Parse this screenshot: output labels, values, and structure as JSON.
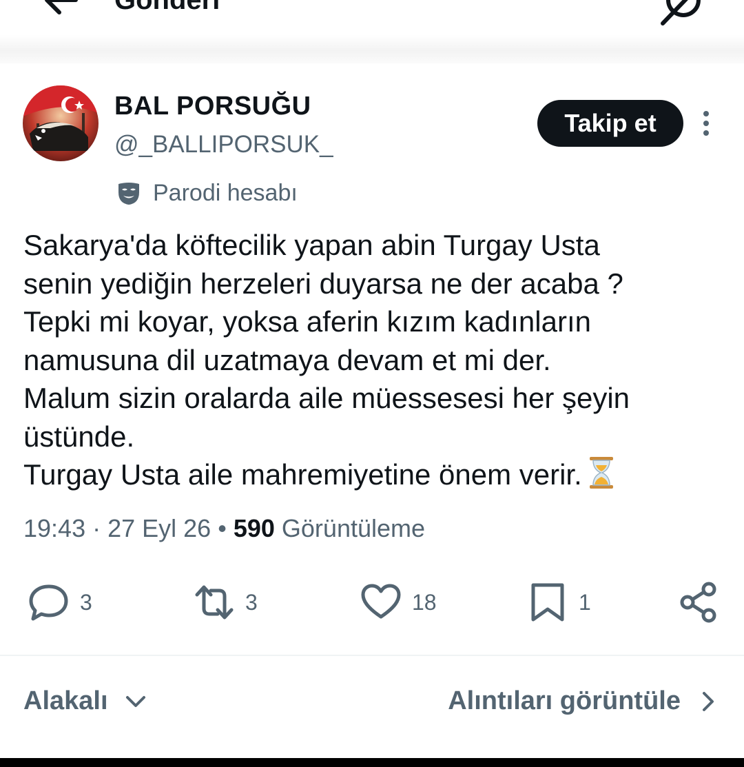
{
  "header": {
    "title": "Gönderi"
  },
  "author": {
    "display_name": "BAL PORSUĞU",
    "handle": "@_BALLIPORSUK_",
    "label": "Parodi hesabı"
  },
  "follow_button": {
    "label": "Takip et"
  },
  "tweet": {
    "lines": [
      "Sakarya'da köftecilik yapan abin Turgay Usta",
      "senin yediğin herzeleri duyarsa ne der acaba ?",
      "Tepki mi koyar, yoksa aferin kızım kadınların",
      "namusuna dil uzatmaya devam et mi der.",
      "Malum sizin oralarda aile müessesesi her şeyin",
      "üstünde.",
      "Turgay Usta aile mahremiyetine önem verir."
    ],
    "emoji": "hourglass"
  },
  "meta": {
    "time": "19:43",
    "date": "27 Eyl 26",
    "views_count": "590",
    "views_label": "Görüntüleme"
  },
  "actions": {
    "replies": "3",
    "reposts": "3",
    "likes": "18",
    "bookmarks": "1"
  },
  "footer": {
    "sort_label": "Alakalı",
    "quotes_label": "Alıntıları görüntüle"
  },
  "colors": {
    "text_primary": "#0f1419",
    "text_secondary": "#536471",
    "divider": "#eff3f4",
    "button_bg": "#0f1419"
  }
}
